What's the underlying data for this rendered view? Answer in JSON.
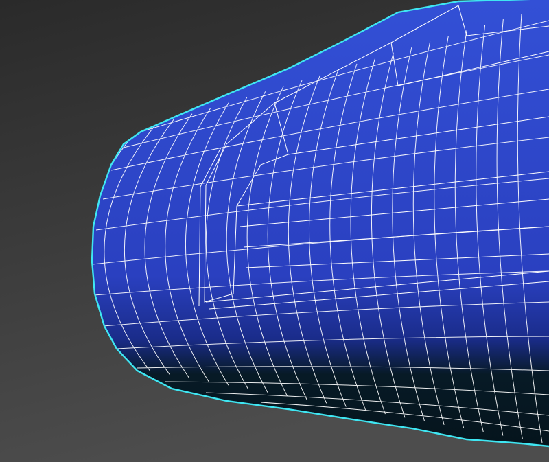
{
  "viewport": {
    "background_top": "#2a2a2a",
    "background_bottom": "#4d4d4d"
  },
  "model": {
    "fill_color": "#2a40c0",
    "fill_highlight": "#3350d6",
    "shadow_color": "#071a26",
    "wire_color": "#ffffff",
    "selection_outline_color": "#3fe6f2"
  }
}
